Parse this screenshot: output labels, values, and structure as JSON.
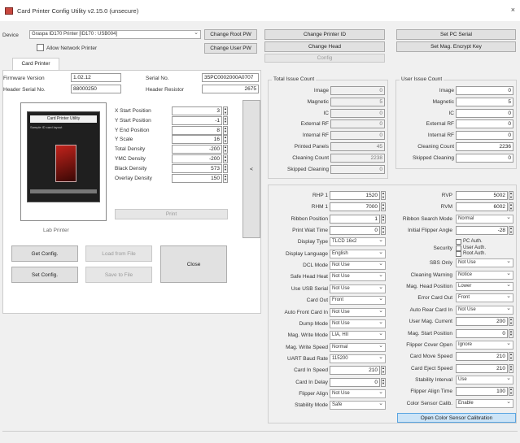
{
  "window": {
    "title": "Card Printer Config Utility v2.15.0 (unsecure)",
    "close": "×"
  },
  "device": {
    "label": "Device",
    "value": "Graspa ID170 Printer [ID170 : USB004]",
    "allow_network": "Allow Network Printer"
  },
  "top_buttons": {
    "change_root_pw": "Change Root PW",
    "change_user_pw": "Change User PW",
    "change_printer_id": "Change Printer ID",
    "change_head": "Change Head",
    "config": "Config",
    "set_pc_serial": "Set PC Serial",
    "set_mag_key": "Set Mag. Encrypt Key"
  },
  "tab": "Card Printer",
  "info": {
    "firmware_label": "Firmware Version",
    "firmware": "1.02.12",
    "serial_label": "Serial No.",
    "serial": "35PC0002000A0707",
    "header_serial_label": "Header Serial No.",
    "header_serial": "88000250",
    "header_resistor_label": "Header Resistor",
    "header_resistor": "2675"
  },
  "preview": {
    "caption": "Lab Printer",
    "card_title": "Card Printer Utility",
    "card_text": "Sample ID card layout"
  },
  "params": [
    {
      "label": "X Start Position",
      "value": "3"
    },
    {
      "label": "Y Start Position",
      "value": "-1"
    },
    {
      "label": "Y End Position",
      "value": "8"
    },
    {
      "label": "Y Scale",
      "value": "16"
    },
    {
      "label": "Total Density",
      "value": "-200"
    },
    {
      "label": "YMC Density",
      "value": "-200"
    },
    {
      "label": "Black Density",
      "value": "573"
    },
    {
      "label": "Overlay Density",
      "value": "150"
    }
  ],
  "print_btn": "Print",
  "arrow_btn": "<",
  "config_btns": {
    "get": "Get Config.",
    "set": "Set Config.",
    "load": "Load from File",
    "save": "Save to File",
    "close": "Close"
  },
  "total_issue": {
    "title": "Total Issue Count",
    "rows": [
      {
        "label": "Image",
        "value": "0"
      },
      {
        "label": "Magnetic",
        "value": "5"
      },
      {
        "label": "IC",
        "value": "0"
      },
      {
        "label": "External RF",
        "value": "0"
      },
      {
        "label": "Internal RF",
        "value": "0"
      },
      {
        "label": "Printed Panels",
        "value": "45"
      },
      {
        "label": "Cleaning Count",
        "value": "2238"
      },
      {
        "label": "Skipped Cleaning",
        "value": "0"
      }
    ]
  },
  "user_issue": {
    "title": "User Issue Count",
    "rows": [
      {
        "label": "Image",
        "value": "0"
      },
      {
        "label": "Magnetic",
        "value": "5"
      },
      {
        "label": "IC",
        "value": "0"
      },
      {
        "label": "External RF",
        "value": "0"
      },
      {
        "label": "Internal RF",
        "value": "0"
      },
      {
        "label": "Cleaning Count",
        "value": "2236"
      },
      {
        "label": "Skipped Cleaning",
        "value": "0"
      }
    ]
  },
  "left_settings": [
    {
      "label": "RHP 1",
      "value": "1520",
      "kind": "spin"
    },
    {
      "label": "RHM 1",
      "value": "7000",
      "kind": "spin"
    },
    {
      "label": "Ribbon Position",
      "value": "1",
      "kind": "spin"
    },
    {
      "label": "Print Wait Time",
      "value": "0",
      "kind": "spin"
    },
    {
      "label": "Display Type",
      "value": "TLCD 16x2",
      "kind": "dd"
    },
    {
      "label": "Display Language",
      "value": "English",
      "kind": "dd"
    },
    {
      "label": "DCL Mode",
      "value": "Not Use",
      "kind": "dd"
    },
    {
      "label": "Safe Head Heat",
      "value": "Not Use",
      "kind": "dd"
    },
    {
      "label": "Use USB Serial",
      "value": "Not Use",
      "kind": "dd"
    },
    {
      "label": "Card Out",
      "value": "Front",
      "kind": "dd"
    },
    {
      "label": "Auto Front Card In",
      "value": "Not Use",
      "kind": "dd"
    },
    {
      "label": "Dump Mode",
      "value": "Not Use",
      "kind": "dd"
    },
    {
      "label": "Mag. Write Mode",
      "value": "LIA, HII",
      "kind": "dd"
    },
    {
      "label": "Mag. Write Speed",
      "value": "Normal",
      "kind": "dd"
    },
    {
      "label": "UART Baud Rate",
      "value": "115200",
      "kind": "dd"
    },
    {
      "label": "Card In Speed",
      "value": "210",
      "kind": "spin"
    },
    {
      "label": "Card In Delay",
      "value": "0",
      "kind": "spin"
    },
    {
      "label": "Flipper Align",
      "value": "Not Use",
      "kind": "dd"
    },
    {
      "label": "Stability Mode",
      "value": "Safe",
      "kind": "dd"
    }
  ],
  "right_settings": [
    {
      "label": "RVP",
      "value": "5002",
      "kind": "spin"
    },
    {
      "label": "RVM",
      "value": "6002",
      "kind": "spin"
    },
    {
      "label": "Ribbon Search Mode",
      "value": "Normal",
      "kind": "dd"
    },
    {
      "label": "Initial Flipper Angle",
      "value": "-28",
      "kind": "spin"
    },
    {
      "label": "Security",
      "value": "",
      "kind": "security"
    },
    {
      "label": "SBS Only",
      "value": "Not Use",
      "kind": "dd"
    },
    {
      "label": "Cleaning Warning",
      "value": "Notice",
      "kind": "dd"
    },
    {
      "label": "Mag. Head Position",
      "value": "Lower",
      "kind": "dd"
    },
    {
      "label": "Error Card Out",
      "value": "Front",
      "kind": "dd"
    },
    {
      "label": "Auto Rear Card In",
      "value": "Not Use",
      "kind": "dd"
    },
    {
      "label": "User Mag. Current",
      "value": "200",
      "kind": "spin"
    },
    {
      "label": "Mag. Start Position",
      "value": "0",
      "kind": "spin"
    },
    {
      "label": "Flipper Cover Open",
      "value": "Ignore",
      "kind": "dd"
    },
    {
      "label": "Card Move Speed",
      "value": "210",
      "kind": "spin"
    },
    {
      "label": "Card Eject Speed",
      "value": "210",
      "kind": "spin"
    },
    {
      "label": "Stability Interval",
      "value": "Use",
      "kind": "dd"
    },
    {
      "label": "Flipper Align Time",
      "value": "100",
      "kind": "spin"
    },
    {
      "label": "Color Sensor Calib.",
      "value": "Enable",
      "kind": "dd"
    }
  ],
  "security_opts": [
    "PC Auth.",
    "User Auth.",
    "Root Auth."
  ],
  "open_calib": "Open Color Sensor Calibration"
}
